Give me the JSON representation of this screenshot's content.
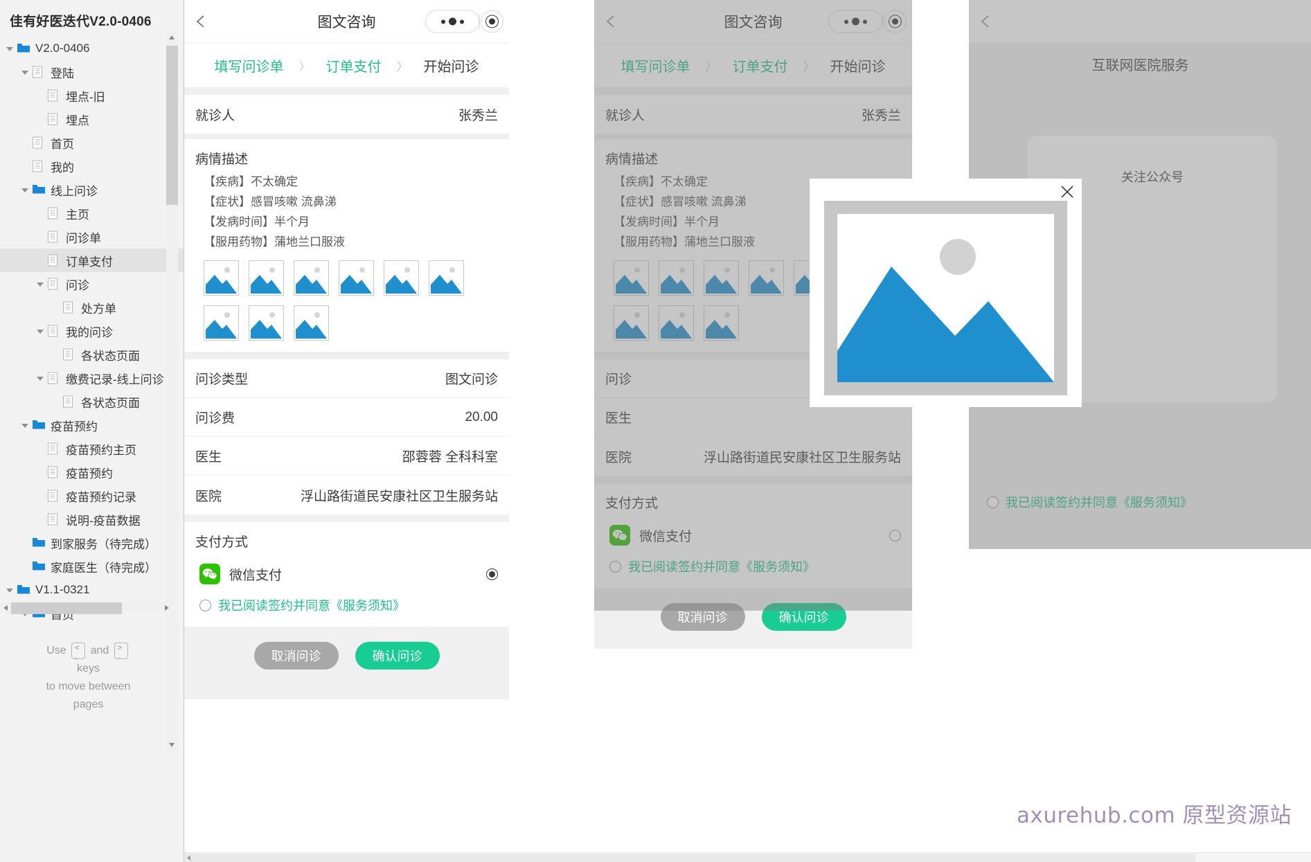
{
  "sidebar": {
    "title": "佳有好医迭代V2.0-0406",
    "tree": [
      {
        "label": "V2.0-0406",
        "indent": 0,
        "type": "folder",
        "arrow": "open",
        "selected": false
      },
      {
        "label": "登陆",
        "indent": 1,
        "type": "page",
        "arrow": "open",
        "selected": false
      },
      {
        "label": "埋点-旧",
        "indent": 2,
        "type": "page",
        "arrow": "none",
        "selected": false
      },
      {
        "label": "埋点",
        "indent": 2,
        "type": "page",
        "arrow": "none",
        "selected": false
      },
      {
        "label": "首页",
        "indent": 1,
        "type": "page",
        "arrow": "none",
        "selected": false
      },
      {
        "label": "我的",
        "indent": 1,
        "type": "page",
        "arrow": "none",
        "selected": false
      },
      {
        "label": "线上问诊",
        "indent": 1,
        "type": "folder",
        "arrow": "open",
        "selected": false
      },
      {
        "label": "主页",
        "indent": 2,
        "type": "page",
        "arrow": "none",
        "selected": false
      },
      {
        "label": "问诊单",
        "indent": 2,
        "type": "page",
        "arrow": "none",
        "selected": false
      },
      {
        "label": "订单支付",
        "indent": 2,
        "type": "page",
        "arrow": "none",
        "selected": true
      },
      {
        "label": "问诊",
        "indent": 2,
        "type": "page",
        "arrow": "open",
        "selected": false
      },
      {
        "label": "处方单",
        "indent": 3,
        "type": "page",
        "arrow": "none",
        "selected": false
      },
      {
        "label": "我的问诊",
        "indent": 2,
        "type": "page",
        "arrow": "open",
        "selected": false
      },
      {
        "label": "各状态页面",
        "indent": 3,
        "type": "page",
        "arrow": "none",
        "selected": false
      },
      {
        "label": "缴费记录-线上问诊",
        "indent": 2,
        "type": "page",
        "arrow": "open",
        "selected": false
      },
      {
        "label": "各状态页面",
        "indent": 3,
        "type": "page",
        "arrow": "none",
        "selected": false
      },
      {
        "label": "疫苗预约",
        "indent": 1,
        "type": "folder",
        "arrow": "open",
        "selected": false
      },
      {
        "label": "疫苗预约主页",
        "indent": 2,
        "type": "page",
        "arrow": "none",
        "selected": false
      },
      {
        "label": "疫苗预约",
        "indent": 2,
        "type": "page",
        "arrow": "none",
        "selected": false
      },
      {
        "label": "疫苗预约记录",
        "indent": 2,
        "type": "page",
        "arrow": "none",
        "selected": false
      },
      {
        "label": "说明-疫苗数据",
        "indent": 2,
        "type": "page",
        "arrow": "none",
        "selected": false
      },
      {
        "label": "到家服务（待完成）",
        "indent": 1,
        "type": "folder",
        "arrow": "none",
        "selected": false
      },
      {
        "label": "家庭医生（待完成）",
        "indent": 1,
        "type": "folder",
        "arrow": "none",
        "selected": false
      },
      {
        "label": "V1.1-0321",
        "indent": 0,
        "type": "folder",
        "arrow": "open",
        "selected": false
      },
      {
        "label": "首页",
        "indent": 1,
        "type": "folder",
        "arrow": "open",
        "selected": false
      }
    ],
    "hint": {
      "use": "Use",
      "and": "and",
      "key_prev_top": "<",
      "key_prev_bottom": ",",
      "key_next_top": ">",
      "key_next_bottom": ".",
      "line2": "keys",
      "line3": "to move between",
      "line4": "pages"
    }
  },
  "phone_a": {
    "nav": {
      "title": "图文咨询",
      "back_icon": "chevron-left-icon"
    },
    "steps": [
      {
        "label": "填写问诊单",
        "state": "done"
      },
      {
        "label": "订单支付",
        "state": "done"
      },
      {
        "label": "开始问诊",
        "state": "current"
      }
    ],
    "step_separator": "〉",
    "patient": {
      "label": "就诊人",
      "value": "张秀兰"
    },
    "condition": {
      "title": "病情描述",
      "lines": [
        "【疾病】不太确定",
        "【症状】感冒咳嗽 流鼻涕",
        "【发病时间】半个月",
        "【服用药物】蒲地兰口服液"
      ],
      "image_count": 9
    },
    "details": [
      {
        "label": "问诊类型",
        "value": "图文问诊"
      },
      {
        "label": "问诊费",
        "value": "20.00"
      },
      {
        "label": "医生",
        "value": "邵蓉蓉 全科科室"
      },
      {
        "label": "医院",
        "value": "浮山路街道民安康社区卫生服务站"
      }
    ],
    "payment": {
      "title": "支付方式",
      "method_label": "微信支付",
      "method_icon": "wechat-icon",
      "method_selected": true,
      "agreement_text": "我已阅读签约并同意《服务须知》",
      "agreement_checked": false
    },
    "footer": {
      "cancel_label": "取消问诊",
      "confirm_label": "确认问诊"
    }
  },
  "phone_b": {
    "nav": {
      "title": "图文咨询"
    },
    "steps": [
      {
        "label": "填写问诊单",
        "state": "done"
      },
      {
        "label": "订单支付",
        "state": "done"
      },
      {
        "label": "开始问诊",
        "state": "current"
      }
    ],
    "patient": {
      "label": "就诊人",
      "value": "张秀兰"
    },
    "condition": {
      "title": "病情描述",
      "lines": [
        "【疾病】不太确定",
        "【症状】感冒咳嗽 流鼻涕",
        "【发病时间】半个月",
        "【服用药物】蒲地兰口服液"
      ]
    },
    "details": [
      {
        "label": "问诊",
        "value": ""
      },
      {
        "label": "医生",
        "value": ""
      },
      {
        "label": "医院",
        "value": "浮山路街道民安康社区卫生服务站"
      }
    ],
    "payment": {
      "title": "支付方式",
      "method_label": "微信支付",
      "agreement_text": "我已阅读签约并同意《服务须知》"
    },
    "footer": {
      "cancel_label": "取消问诊",
      "confirm_label": "确认问诊"
    },
    "lightbox": {
      "close_icon": "close-icon",
      "image_alt": "image-placeholder"
    }
  },
  "phone_c": {
    "nav": {
      "title": ""
    },
    "header_text": "互联网医院服务",
    "sheet_text": "关注公众号",
    "agreement_text": "我已阅读签约并同意《服务须知》"
  },
  "watermark": "axurehub.com 原型资源站",
  "colors": {
    "accent_green": "#20c08a",
    "button_green": "#17cd91",
    "button_grey": "#a8a8a8",
    "folder_blue": "#1787d8",
    "image_blue": "#1f8fcd",
    "wechat_green": "#2dc100",
    "watermark_purple": "#9b8ab5"
  }
}
